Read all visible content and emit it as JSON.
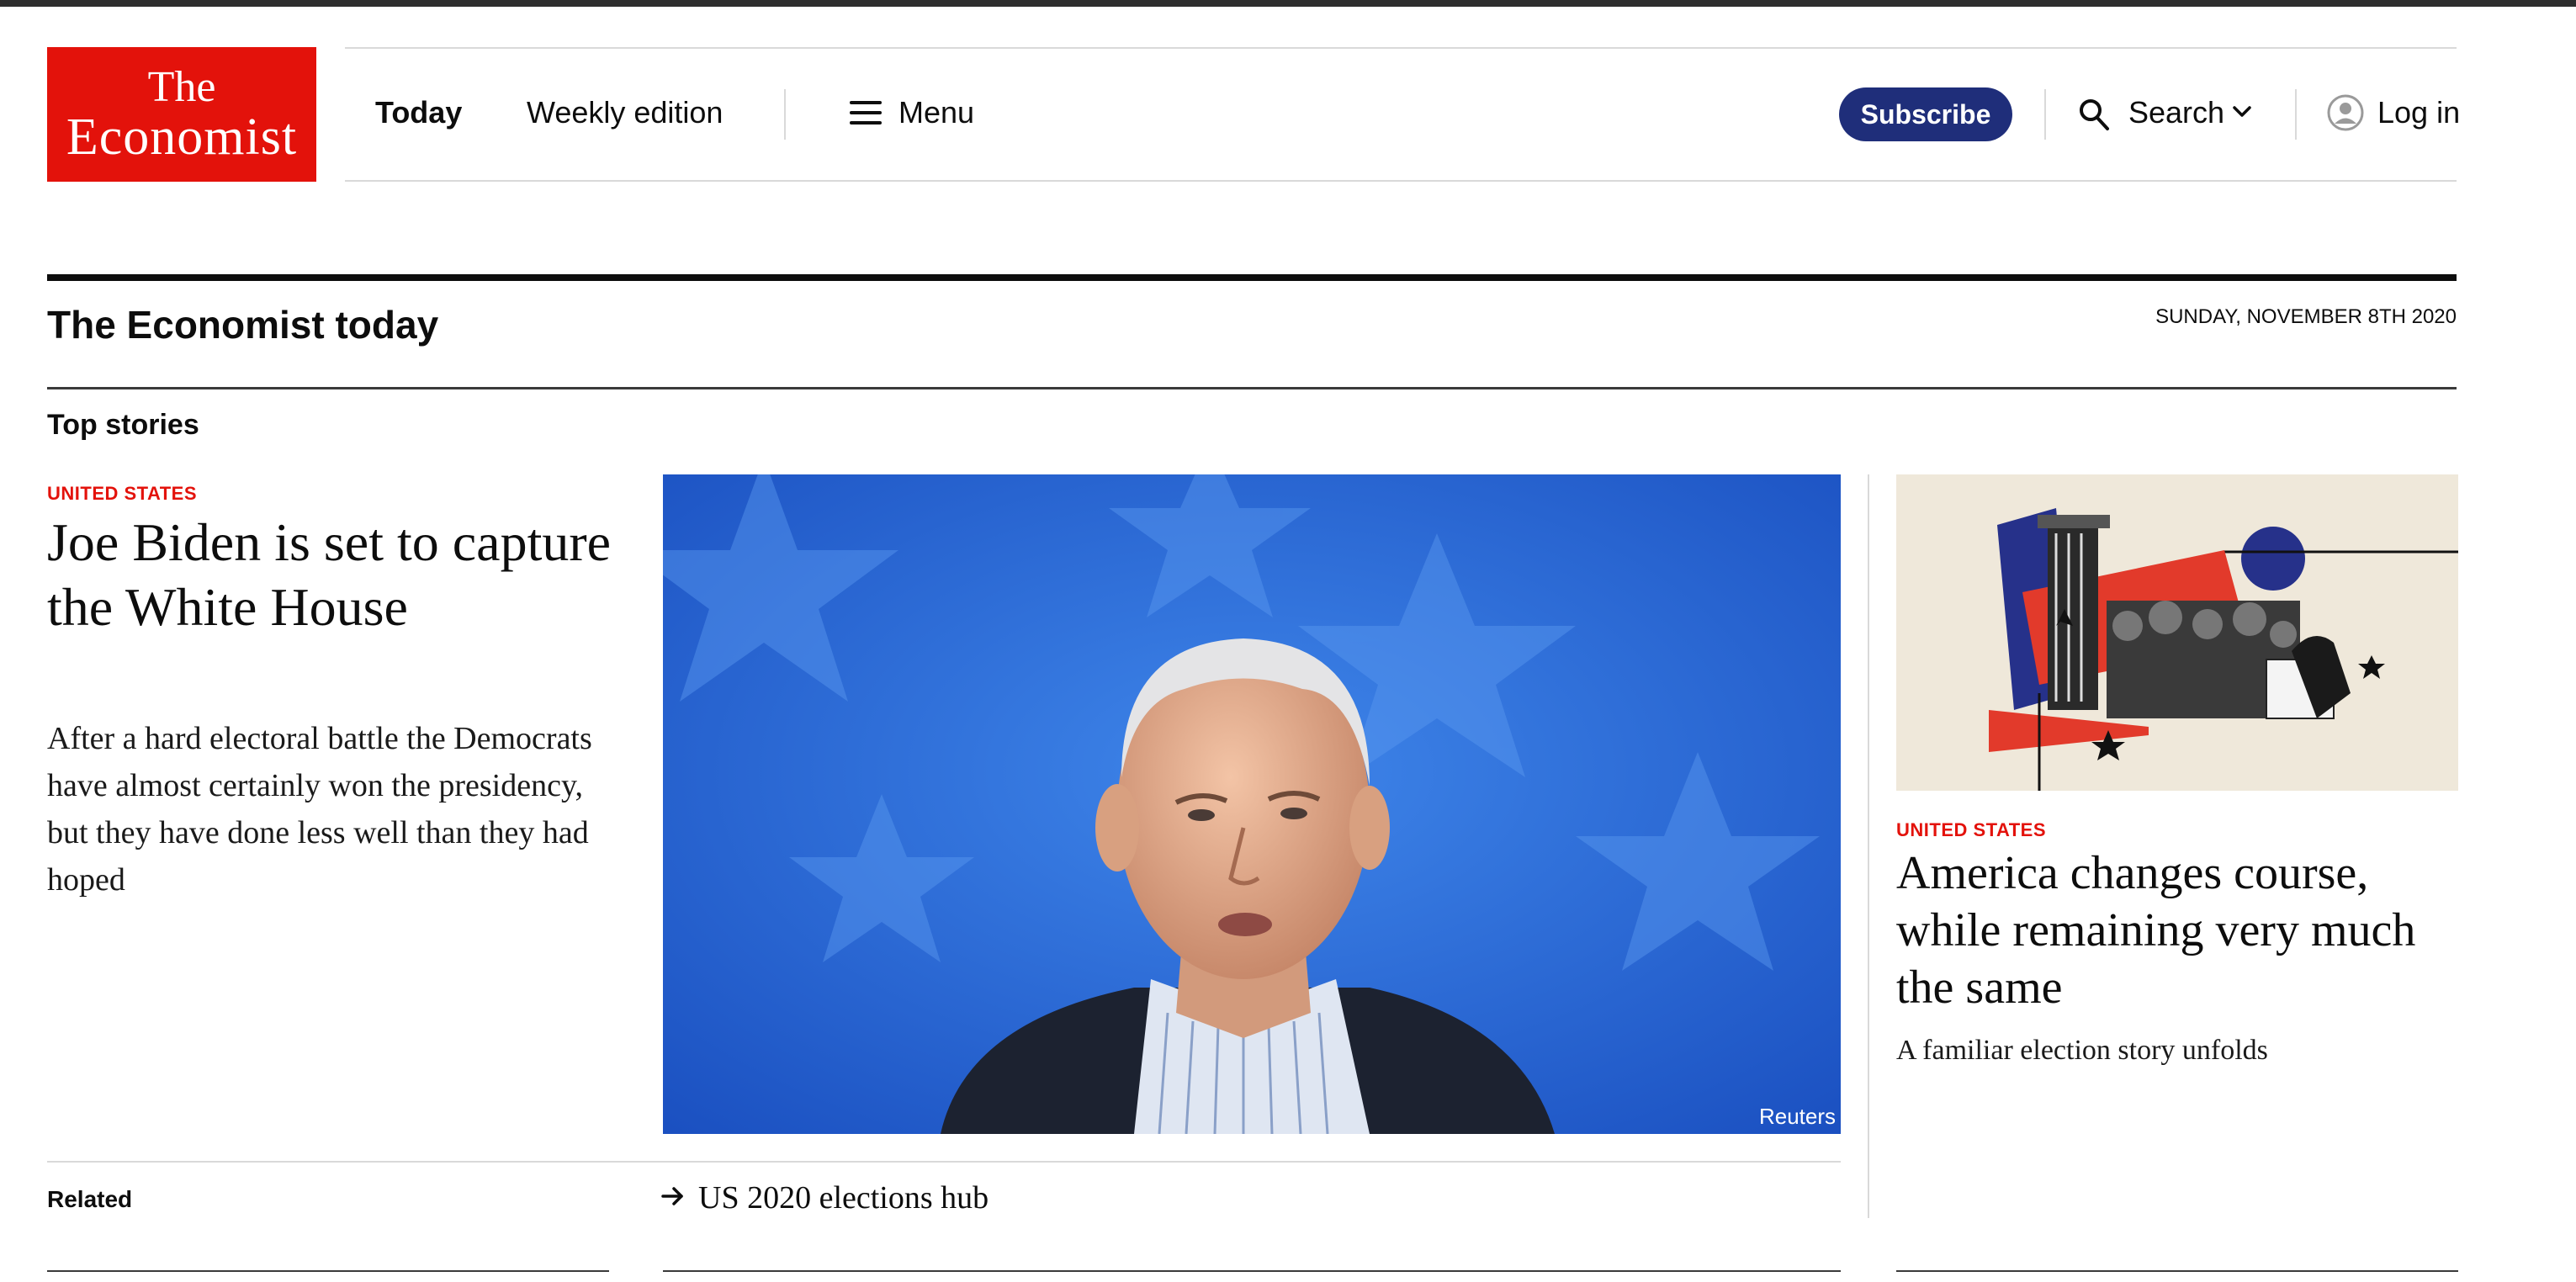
{
  "brand": {
    "line1": "The",
    "line2": "Economist",
    "color": "#e3120b"
  },
  "nav": {
    "today": "Today",
    "weekly": "Weekly edition",
    "menu": "Menu",
    "subscribe": "Subscribe",
    "search": "Search",
    "login": "Log in",
    "subscribe_color": "#1f2e7a"
  },
  "icons": [
    "menu-icon",
    "search-icon",
    "chevron-down-icon",
    "user-icon",
    "arrow-right-icon"
  ],
  "section": {
    "title": "The Economist today",
    "date": "SUNDAY, NOVEMBER 8TH 2020",
    "top_stories": "Top stories"
  },
  "lead_story": {
    "kicker": "UNITED STATES",
    "headline": "Joe Biden is set to capture the White House",
    "summary": "After a hard electoral battle the Democrats have almost certainly won the presidency, but they have done less well than they had hoped",
    "image_credit": "Reuters"
  },
  "second_story": {
    "kicker": "UNITED STATES",
    "headline": "America changes course, while remaining very much the same",
    "summary": "A familiar election story unfolds"
  },
  "related": {
    "label": "Related",
    "link": "US 2020 elections hub"
  }
}
